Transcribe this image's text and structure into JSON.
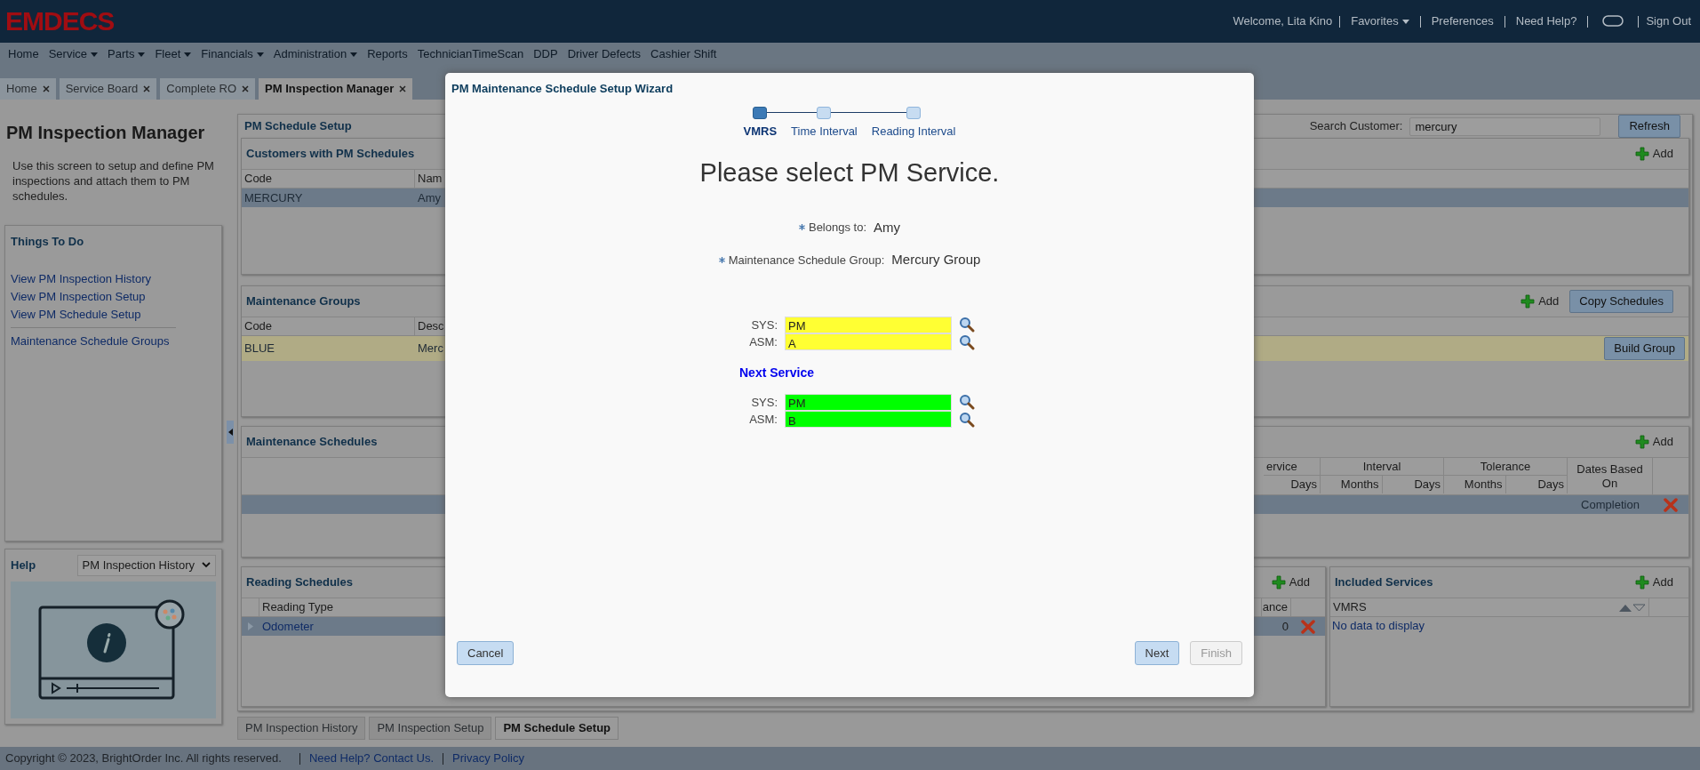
{
  "header": {
    "logo": "EMDECS",
    "welcome": "Welcome, Lita Kino",
    "links": [
      {
        "label": "Favorites",
        "dropdown": true
      },
      {
        "label": "Preferences",
        "dropdown": false
      },
      {
        "label": "Need Help?",
        "dropdown": false
      }
    ],
    "sign_out": "Sign Out"
  },
  "menu": [
    {
      "label": "Home",
      "dropdown": false
    },
    {
      "label": "Service",
      "dropdown": true
    },
    {
      "label": "Parts",
      "dropdown": true
    },
    {
      "label": "Fleet",
      "dropdown": true
    },
    {
      "label": "Financials",
      "dropdown": true
    },
    {
      "label": "Administration",
      "dropdown": true
    },
    {
      "label": "Reports",
      "dropdown": false
    },
    {
      "label": "TechnicianTimeScan",
      "dropdown": false
    },
    {
      "label": "DDP",
      "dropdown": false
    },
    {
      "label": "Driver Defects",
      "dropdown": false
    },
    {
      "label": "Cashier Shift",
      "dropdown": false
    }
  ],
  "tabs": [
    {
      "label": "Home",
      "selected": false
    },
    {
      "label": "Service Board",
      "selected": false
    },
    {
      "label": "Complete RO",
      "selected": false
    },
    {
      "label": "PM Inspection Manager",
      "selected": true
    }
  ],
  "left": {
    "title": "PM Inspection Manager",
    "description": "Use this screen to setup and define PM inspections and attach them to PM schedules.",
    "things_title": "Things To Do",
    "links": [
      "View PM Inspection History",
      "View PM Inspection Setup",
      "View PM Schedule Setup"
    ],
    "more_links": [
      "Maintenance Schedule Groups"
    ],
    "help_title": "Help",
    "help_topic": "PM Inspection History"
  },
  "main": {
    "title": "PM Schedule Setup",
    "search_label": "Search Customer:",
    "search_value": "mercury",
    "refresh": "Refresh",
    "customers": {
      "title": "Customers with PM Schedules",
      "add": "Add",
      "columns": [
        "Code",
        "Nam"
      ],
      "rows": [
        {
          "cells": [
            "MERCURY",
            "Amy"
          ],
          "selected": true
        }
      ]
    },
    "groups": {
      "title": "Maintenance Groups",
      "add": "Add",
      "copy": "Copy Schedules",
      "columns": [
        "Code",
        "Desc"
      ],
      "rows": [
        {
          "cells": [
            "BLUE",
            "Merc"
          ],
          "highlighted": true,
          "action": "Build Group"
        }
      ]
    },
    "schedules": {
      "title": "Maintenance Schedules",
      "add": "Add",
      "header_groups": [
        "ervice",
        "Interval",
        "Tolerance"
      ],
      "sub_columns": [
        "Days",
        "Months",
        "Days",
        "Months",
        "Days"
      ],
      "dates_column": "Dates Based On",
      "rows": [
        {
          "dates_based_on": "Completion",
          "selected": true
        }
      ]
    },
    "readings": {
      "title": "Reading Schedules",
      "add": "Add",
      "columns": [
        "Reading Type"
      ],
      "cut_column": "ance",
      "rows": [
        {
          "type": "Odometer",
          "value": "0",
          "selected": true
        }
      ]
    },
    "included": {
      "title": "Included Services",
      "add": "Add",
      "columns": [
        "VMRS"
      ],
      "empty": "No data to display"
    }
  },
  "bottom_tabs": [
    {
      "label": "PM Inspection History",
      "selected": false
    },
    {
      "label": "PM Inspection Setup",
      "selected": false
    },
    {
      "label": "PM Schedule Setup",
      "selected": true
    }
  ],
  "footer": {
    "copyright": "Copyright © 2023, BrightOrder Inc. All rights reserved.",
    "links": [
      "Need Help? Contact Us.",
      "Privacy Policy"
    ]
  },
  "wizard": {
    "title": "PM Maintenance Schedule Setup Wizard",
    "steps": [
      {
        "label": "VMRS",
        "selected": true
      },
      {
        "label": "Time Interval",
        "selected": false
      },
      {
        "label": "Reading Interval",
        "selected": false
      }
    ],
    "heading": "Please select PM Service.",
    "info": [
      {
        "label": "Belongs to:",
        "value": "Amy",
        "required": true
      },
      {
        "label": "Maintenance Schedule Group:",
        "value": "Mercury Group",
        "required": true
      }
    ],
    "current": [
      {
        "label": "SYS:",
        "value": "PM",
        "color": "#ffff33"
      },
      {
        "label": "ASM:",
        "value": "A",
        "color": "#ffff33"
      }
    ],
    "next_title": "Next Service",
    "next": [
      {
        "label": "SYS:",
        "value": "PM",
        "color": "#00ff00"
      },
      {
        "label": "ASM:",
        "value": "B",
        "color": "#00ff00"
      }
    ],
    "buttons": [
      {
        "label": "Cancel",
        "kind": "cancel",
        "disabled": false
      },
      {
        "label": "Next",
        "kind": "next",
        "disabled": false
      },
      {
        "label": "Finish",
        "kind": "finish",
        "disabled": true
      }
    ]
  }
}
